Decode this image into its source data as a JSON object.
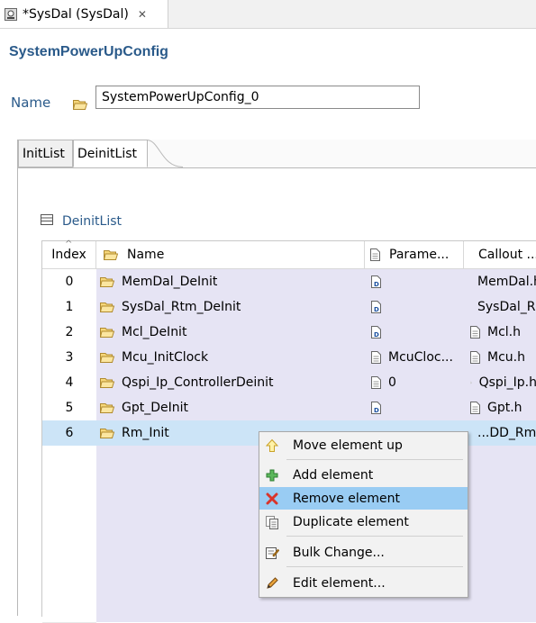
{
  "editor_tab": {
    "title": "*SysDal (SysDal)",
    "close": "✕"
  },
  "section_title": "SystemPowerUpConfig",
  "name_field": {
    "label": "Name",
    "value": "SystemPowerUpConfig_0"
  },
  "tabs": {
    "init": "InitList",
    "deinit": "DeinitList"
  },
  "table_title": "DeinitList",
  "columns": {
    "index": "Index",
    "name": "Name",
    "params": "Parame...",
    "callout": "Callout ..."
  },
  "rows": [
    {
      "index": "0",
      "name": "MemDal_DeInit",
      "params": "",
      "callout": "MemDal.h"
    },
    {
      "index": "1",
      "name": "SysDal_Rtm_DeInit",
      "params": "",
      "callout": "SysDal_R..."
    },
    {
      "index": "2",
      "name": "Mcl_DeInit",
      "params": "",
      "callout": "Mcl.h"
    },
    {
      "index": "3",
      "name": "Mcu_InitClock",
      "params": "McuCloc...",
      "callout": "Mcu.h"
    },
    {
      "index": "4",
      "name": "Qspi_Ip_ControllerDeinit",
      "params": "0",
      "callout": "Qspi_Ip.h"
    },
    {
      "index": "5",
      "name": "Gpt_DeInit",
      "params": "",
      "callout": "Gpt.h"
    },
    {
      "index": "6",
      "name": "Rm_Init",
      "params": "",
      "callout": "...DD_Rm..."
    }
  ],
  "context_menu": {
    "move_up": "Move element up",
    "add": "Add element",
    "remove": "Remove element",
    "duplicate": "Duplicate element",
    "bulk": "Bulk Change...",
    "edit": "Edit element..."
  },
  "colors": {
    "accent": "#2a5a8a",
    "row_fill": "#e6e4f4",
    "selection": "#cce4f7",
    "menu_hover": "#99ccf3"
  }
}
